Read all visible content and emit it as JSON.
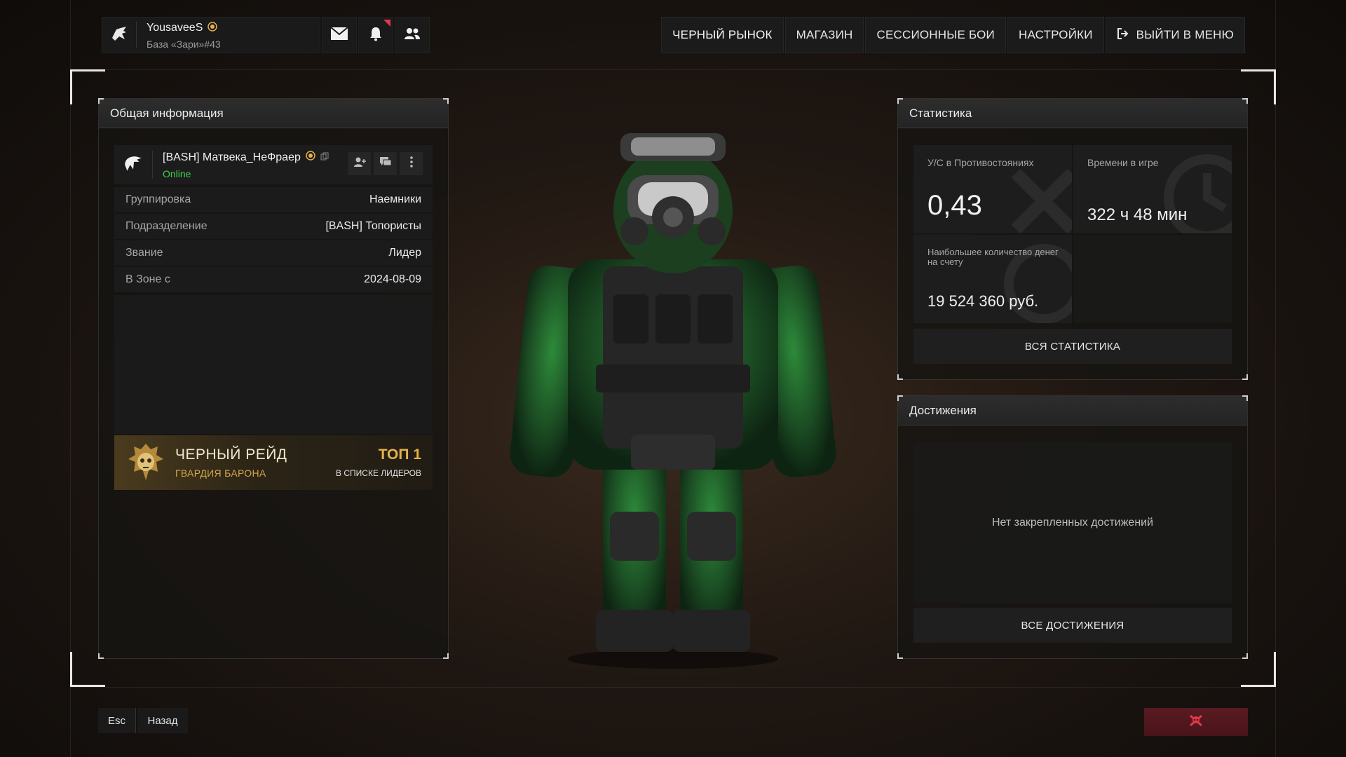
{
  "header": {
    "username": "YousaveeS",
    "base": "База «Зари»#43",
    "nav": [
      {
        "label": "ЧЕРНЫЙ РЫНОК"
      },
      {
        "label": "МАГАЗИН"
      },
      {
        "label": "СЕССИОННЫЕ БОИ"
      },
      {
        "label": "НАСТРОЙКИ"
      },
      {
        "label": "ВЫЙТИ В МЕНЮ"
      }
    ]
  },
  "info_panel": {
    "title": "Общая информация",
    "player_name": "[BASH] Матвека_НеФраер",
    "status": "Online",
    "rows": [
      {
        "key": "Группировка",
        "value": "Наемники"
      },
      {
        "key": "Подразделение",
        "value": "[BASH] Топористы"
      },
      {
        "key": "Звание",
        "value": "Лидер"
      },
      {
        "key": "В Зоне с",
        "value": "2024-08-09"
      }
    ],
    "raid": {
      "title": "ЧЕРНЫЙ РЕЙД",
      "subtitle": "ГВАРДИЯ БАРОНА",
      "rank": "ТОП 1",
      "rank_label": "В СПИСКЕ ЛИДЕРОВ"
    }
  },
  "stats_panel": {
    "title": "Статистика",
    "kd_label": "У/С в Противостояниях",
    "kd_value": "0,43",
    "time_label": "Времени в игре",
    "time_value": "322 ч 48 мин",
    "money_label": "Наибольшее количество денег на счету",
    "money_value": "19 524 360 руб.",
    "all_stats_button": "ВСЯ СТАТИСТИКА"
  },
  "achievements_panel": {
    "title": "Достижения",
    "empty_text": "Нет закрепленных достижений",
    "all_button": "ВСЕ ДОСТИЖЕНИЯ"
  },
  "footer": {
    "esc_key": "Esc",
    "back_label": "Назад"
  },
  "colors": {
    "online": "#3ed14a",
    "gold": "#e3b24a",
    "danger": "#e0394a"
  }
}
